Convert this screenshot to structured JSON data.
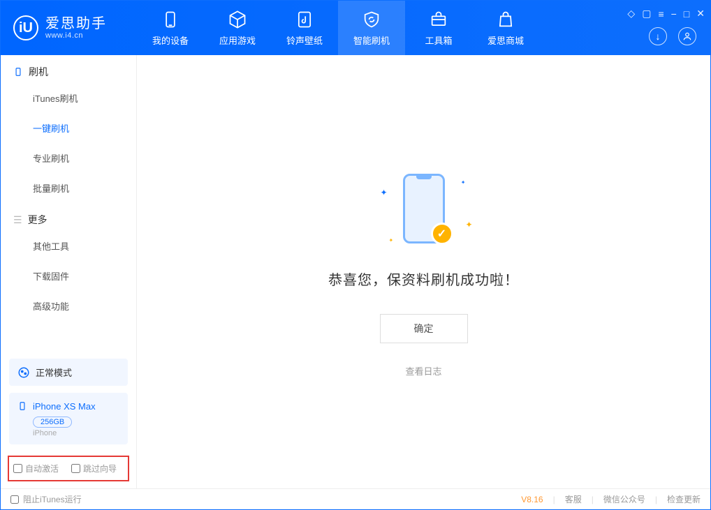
{
  "header": {
    "app_name": "爱思助手",
    "app_url": "www.i4.cn",
    "tabs": [
      {
        "label": "我的设备"
      },
      {
        "label": "应用游戏"
      },
      {
        "label": "铃声壁纸"
      },
      {
        "label": "智能刷机"
      },
      {
        "label": "工具箱"
      },
      {
        "label": "爱思商城"
      }
    ]
  },
  "sidebar": {
    "section1_title": "刷机",
    "section1_items": [
      {
        "label": "iTunes刷机"
      },
      {
        "label": "一键刷机"
      },
      {
        "label": "专业刷机"
      },
      {
        "label": "批量刷机"
      }
    ],
    "section2_title": "更多",
    "section2_items": [
      {
        "label": "其他工具"
      },
      {
        "label": "下载固件"
      },
      {
        "label": "高级功能"
      }
    ],
    "mode_label": "正常模式",
    "device_name": "iPhone XS Max",
    "device_capacity": "256GB",
    "device_type": "iPhone",
    "checkbox1": "自动激活",
    "checkbox2": "跳过向导"
  },
  "main": {
    "success_text": "恭喜您，保资料刷机成功啦！",
    "confirm_button": "确定",
    "log_link": "查看日志"
  },
  "footer": {
    "block_itunes": "阻止iTunes运行",
    "version": "V8.16",
    "link1": "客服",
    "link2": "微信公众号",
    "link3": "检查更新"
  }
}
